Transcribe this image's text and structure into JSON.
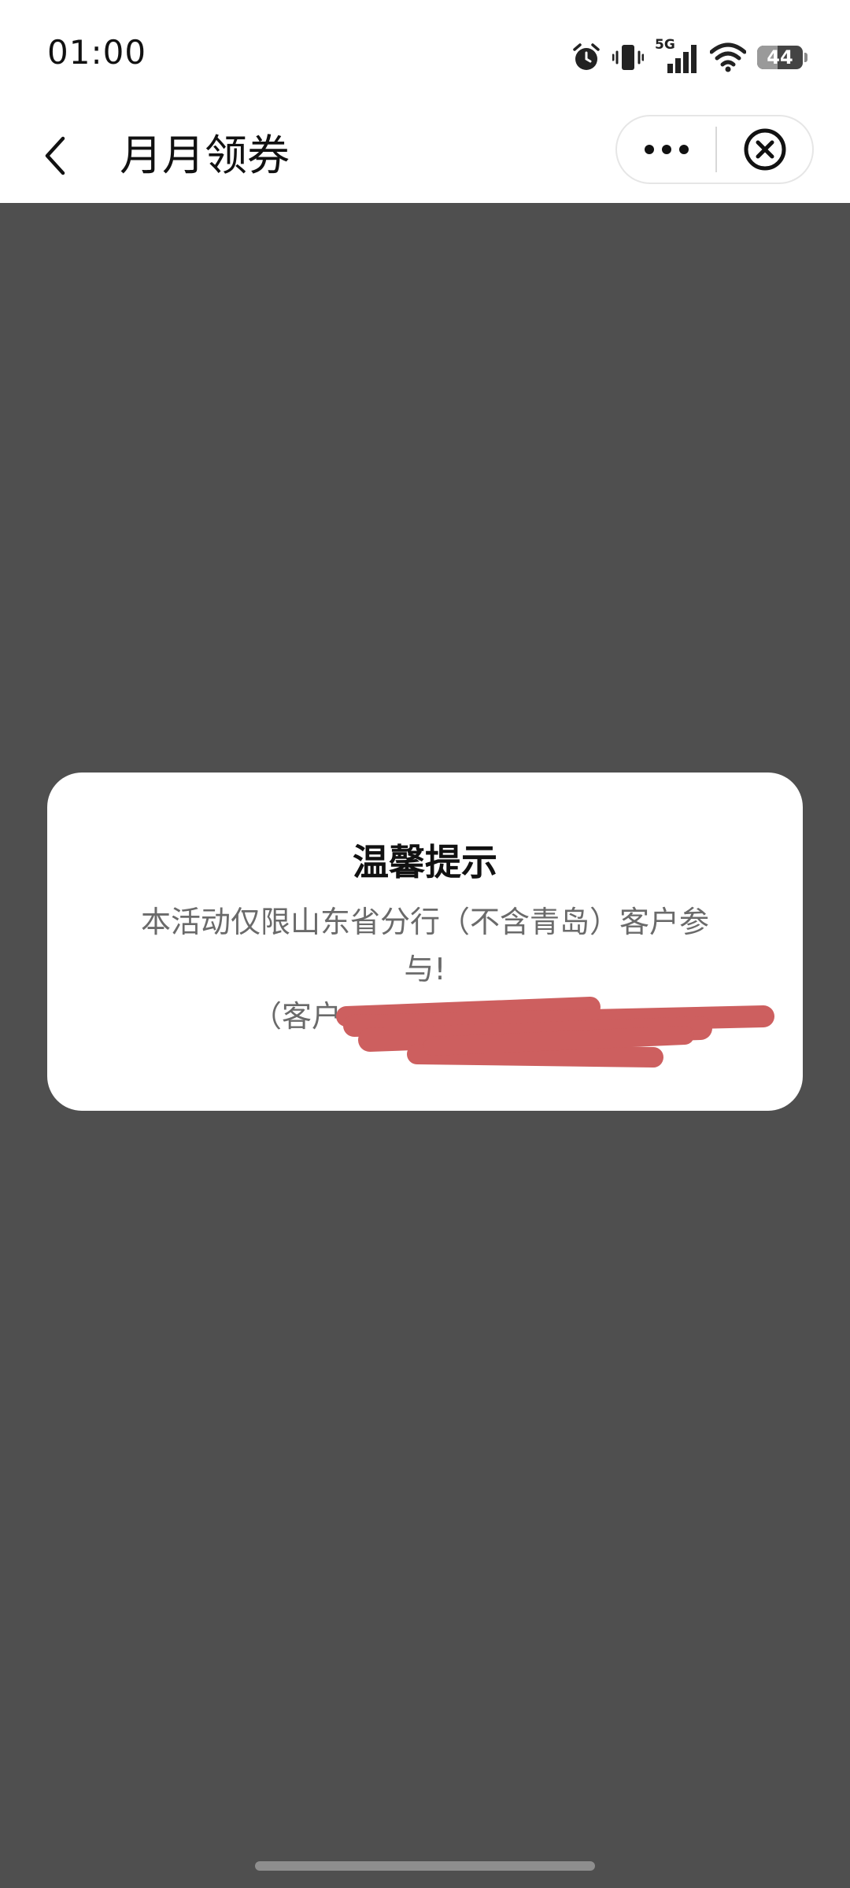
{
  "status_bar": {
    "time": "01:00",
    "network_label": "5G",
    "battery_level": "44",
    "icons": [
      "alarm-icon",
      "vibrate-icon",
      "signal-icon",
      "wifi-icon",
      "battery-icon"
    ]
  },
  "nav_bar": {
    "title": "月月领券",
    "icons": [
      "back-arrow-icon",
      "more-dots-icon",
      "close-circle-icon"
    ]
  },
  "dialog": {
    "title": "温馨提示",
    "message_line1": "本活动仅限山东省分行（不含青岛）客户参",
    "message_line2": "与!",
    "message_line3": "（客户"
  },
  "colors": {
    "overlay": "#4f4f4f",
    "redaction": "#cd5f5f",
    "title_text": "#111111",
    "message_text": "#6a6a6a"
  }
}
